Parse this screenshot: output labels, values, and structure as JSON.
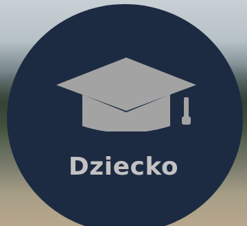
{
  "tile": {
    "label": "Dziecko",
    "icon": "graduation-cap-icon",
    "circle_color": "#1d2b42",
    "icon_color": "#a3a3a3",
    "label_color": "#c2c2c2"
  }
}
